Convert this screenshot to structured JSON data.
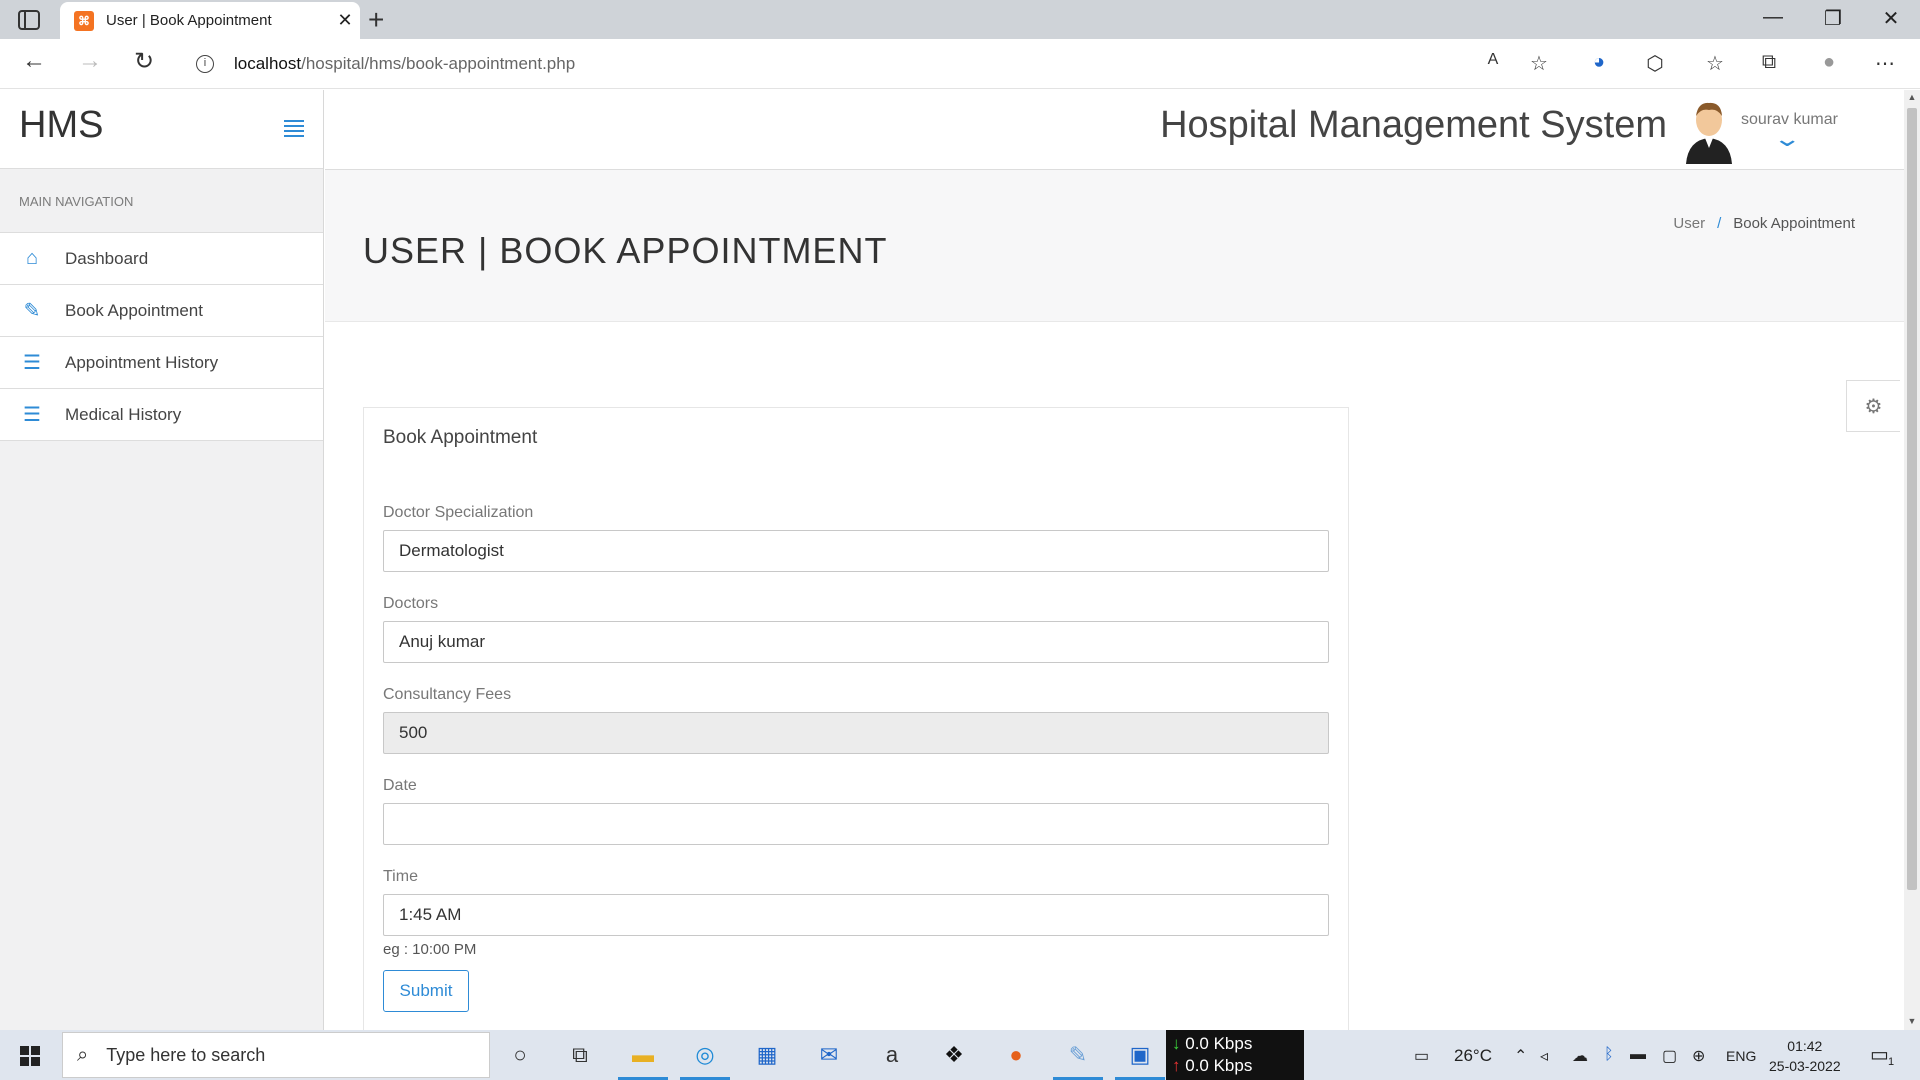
{
  "browser": {
    "tab_title": "User | Book Appointment",
    "url_host": "localhost",
    "url_path": "/hospital/hms/book-appointment.php"
  },
  "sidebar": {
    "brand": "HMS",
    "nav_header": "MAIN NAVIGATION",
    "items": [
      {
        "label": "Dashboard",
        "icon": "home-icon"
      },
      {
        "label": "Book Appointment",
        "icon": "edit-icon"
      },
      {
        "label": "Appointment History",
        "icon": "list-icon"
      },
      {
        "label": "Medical History",
        "icon": "list-icon"
      }
    ]
  },
  "topbar": {
    "title": "Hospital Management System",
    "user_name": "sourav kumar"
  },
  "page": {
    "title": "USER | BOOK APPOINTMENT",
    "breadcrumb": [
      "User",
      "Book Appointment"
    ]
  },
  "form": {
    "panel_title": "Book Appointment",
    "specialization_label": "Doctor Specialization",
    "specialization_value": "Dermatologist",
    "doctors_label": "Doctors",
    "doctors_value": "Anuj kumar",
    "fees_label": "Consultancy Fees",
    "fees_value": "500",
    "date_label": "Date",
    "date_value": "",
    "time_label": "Time",
    "time_value": "1:45 AM",
    "time_hint": "eg : 10:00 PM",
    "submit_label": "Submit"
  },
  "taskbar": {
    "search_placeholder": "Type here to search",
    "net_down": "0.0 Kbps",
    "net_up": "0.0 Kbps",
    "temperature": "26°C",
    "language": "ENG",
    "time": "01:42",
    "date": "25-03-2022",
    "notification_count": "1"
  },
  "colors": {
    "accent": "#2e8bd6",
    "sidebar_bg": "#f1f1f2",
    "page_head_bg": "#f7f7f8"
  }
}
